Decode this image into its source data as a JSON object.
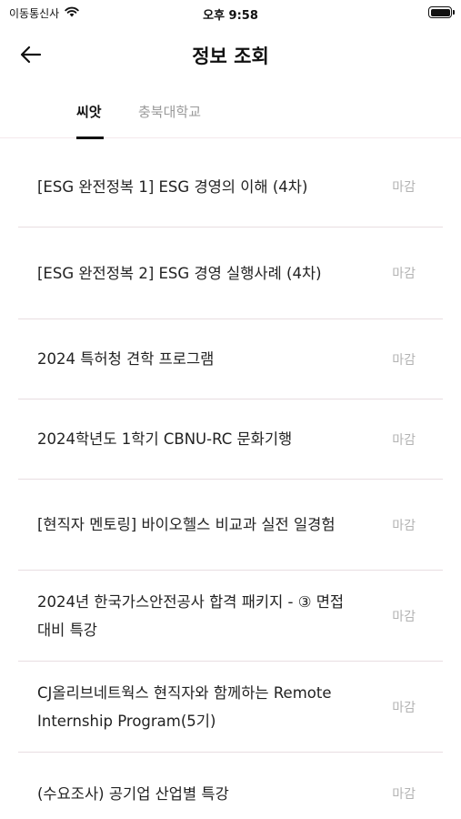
{
  "status_bar": {
    "carrier": "이동통신사",
    "time": "오후 9:58"
  },
  "header": {
    "title": "정보 조회"
  },
  "tabs": [
    {
      "label": "씨앗",
      "active": true
    },
    {
      "label": "충북대학교",
      "active": false
    }
  ],
  "items": [
    {
      "title": "[ESG 완전정복 1] ESG 경영의 이해 (4차)",
      "status": "마감"
    },
    {
      "title": "[ESG 완전정복 2] ESG 경영 실행사례 (4차)",
      "status": "마감"
    },
    {
      "title": "2024 특허청 견학 프로그램",
      "status": "마감"
    },
    {
      "title": "2024학년도 1학기 CBNU-RC 문화기행",
      "status": "마감"
    },
    {
      "title": "[현직자 멘토링] 바이오헬스 비교과 실전 일경험",
      "status": "마감"
    },
    {
      "title": "2024년 한국가스안전공사 합격 패키지 - ③ 면접 대비 특강",
      "status": "마감"
    },
    {
      "title": "CJ올리브네트웍스 현직자와 함께하는 Remote Internship Program(5기)",
      "status": "마감"
    },
    {
      "title": "(수요조사) 공기업 산업별 특강",
      "status": "마감"
    }
  ]
}
